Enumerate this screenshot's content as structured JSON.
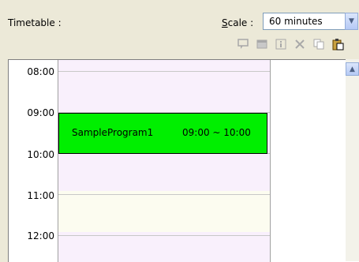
{
  "header": {
    "title": "Timetable :",
    "scale_label_underlined": "S",
    "scale_label_rest": "cale :",
    "scale_value": "60 minutes"
  },
  "toolbar": {
    "icons": [
      {
        "name": "program-view-icon",
        "glyph": "💬",
        "enabled": false
      },
      {
        "name": "properties-icon",
        "glyph": "▭",
        "enabled": false
      },
      {
        "name": "info-icon",
        "glyph": "ⓘ",
        "enabled": false
      },
      {
        "name": "delete-icon",
        "glyph": "✕",
        "enabled": false
      },
      {
        "name": "copy-icon",
        "glyph": "⎘",
        "enabled": false
      },
      {
        "name": "paste-icon",
        "glyph": "📋",
        "enabled": true
      }
    ]
  },
  "timetable": {
    "times": [
      "08:00",
      "09:00",
      "10:00",
      "11:00",
      "12:00"
    ],
    "event": {
      "name": "SampleProgram1",
      "range": "09:00 ~ 10:00",
      "color": "#00ef00"
    }
  }
}
